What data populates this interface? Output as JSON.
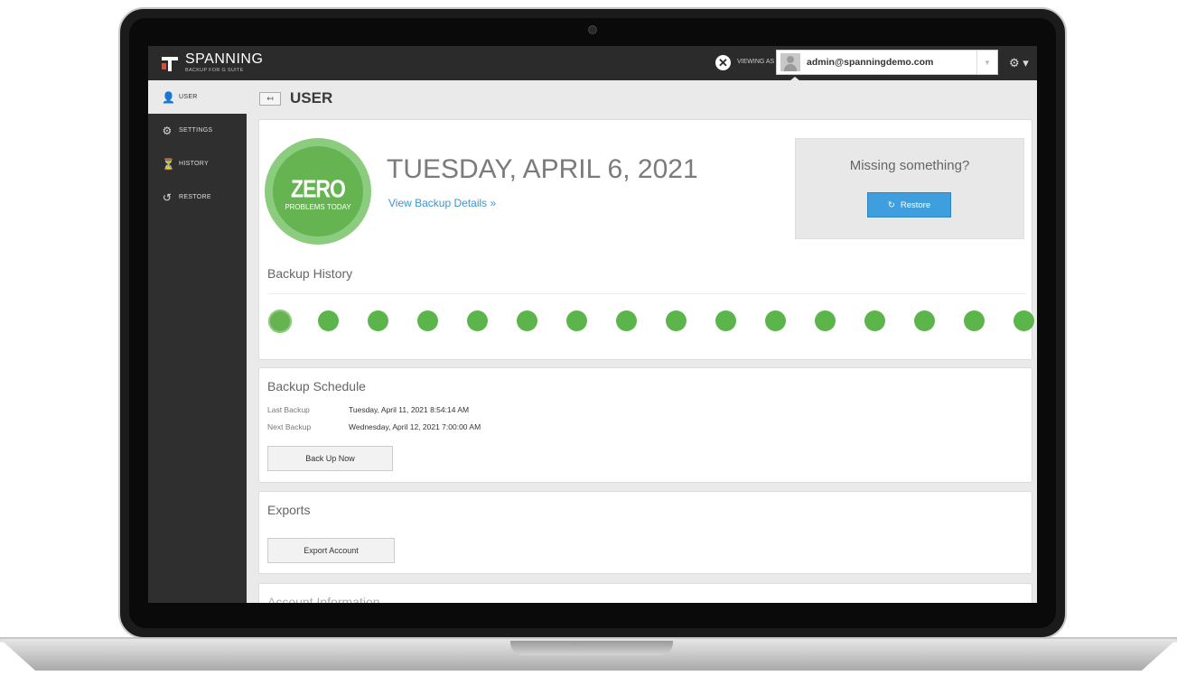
{
  "app": {
    "brand_title": "SPANNING",
    "brand_subtitle": "BACKUP FOR G SUITE",
    "viewing_as_label": "VIEWING AS",
    "current_user_email": "admin@spanningdemo.com",
    "close_icon": "close-circle-icon",
    "gear_icon": "gear-icon"
  },
  "sidebar": {
    "items": [
      {
        "label": "USER",
        "icon": "user-icon",
        "glyph": "👤",
        "active": true
      },
      {
        "label": "SETTINGS",
        "icon": "settings-icon",
        "glyph": "⚙",
        "active": false
      },
      {
        "label": "HISTORY",
        "icon": "history-icon",
        "glyph": "⏳",
        "active": false
      },
      {
        "label": "RESTORE",
        "icon": "restore-icon",
        "glyph": "↺",
        "active": false
      }
    ]
  },
  "header": {
    "title": "USER",
    "back_icon": "back-arrow-icon",
    "back_glyph": "↤"
  },
  "status": {
    "badge_big": "ZERO",
    "badge_small": "PROBLEMS TODAY",
    "date": "TUESDAY, APRIL 6, 2021",
    "details_link": "View Backup Details »"
  },
  "restore_panel": {
    "prompt": "Missing something?",
    "button_label": "Restore",
    "button_icon": "refresh-icon",
    "button_glyph": "↻"
  },
  "backup_history": {
    "title": "Backup History",
    "dot_count": 16
  },
  "schedule": {
    "title": "Backup Schedule",
    "last_label": "Last Backup",
    "last_value": "Tuesday, April 11, 2021 8:54:14 AM",
    "next_label": "Next Backup",
    "next_value": "Wednesday, April 12, 2021 7:00:00 AM",
    "button_label": "Back Up Now"
  },
  "exports": {
    "title": "Exports",
    "button_label": "Export Account"
  },
  "account": {
    "title": "Account Information"
  },
  "colors": {
    "success": "#5cb54a",
    "primary": "#3f9ede",
    "topbar": "#2b2b2b",
    "sidebar": "#2f2f2f"
  }
}
